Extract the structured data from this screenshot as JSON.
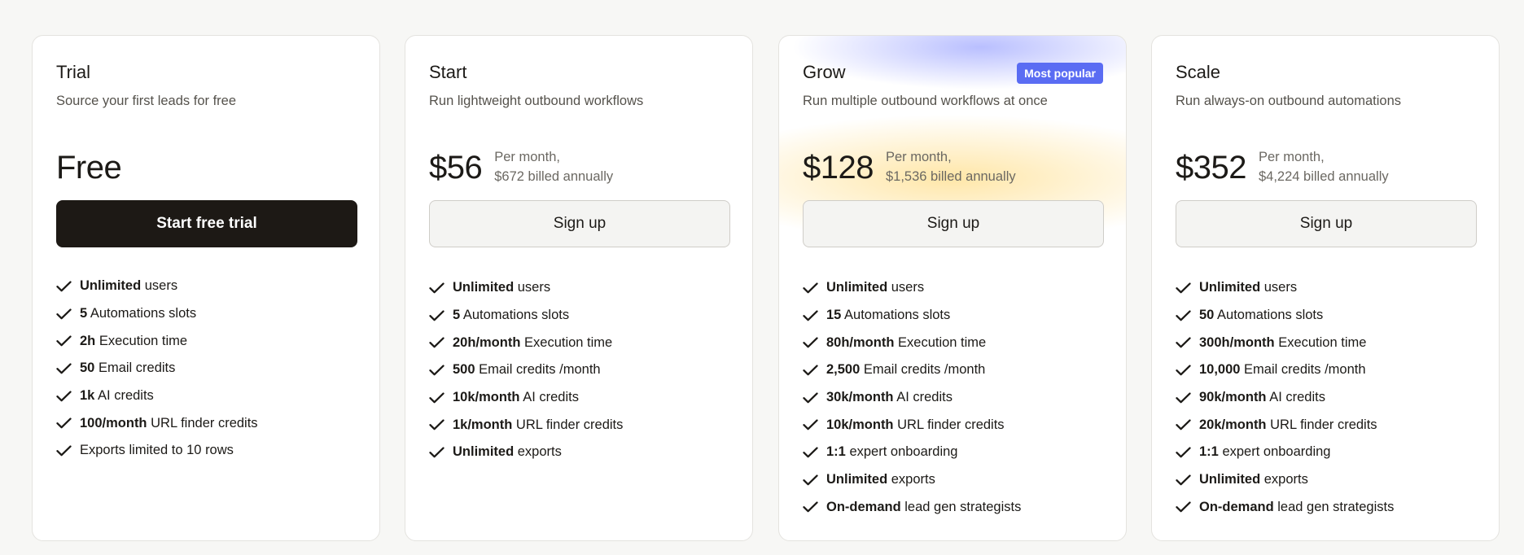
{
  "plans": [
    {
      "name": "Trial",
      "description": "Source your first leads for free",
      "price": "Free",
      "cta": "Start free trial",
      "features": [
        {
          "bold": "Unlimited",
          "rest": " users"
        },
        {
          "bold": "5",
          "rest": " Automations slots"
        },
        {
          "bold": "2h",
          "rest": " Execution time"
        },
        {
          "bold": "50",
          "rest": " Email credits"
        },
        {
          "bold": "1k",
          "rest": " AI credits"
        },
        {
          "bold": "100/month",
          "rest": " URL finder credits"
        },
        {
          "bold": "",
          "rest": "Exports limited to 10 rows"
        }
      ]
    },
    {
      "name": "Start",
      "description": "Run lightweight outbound workflows",
      "price": "$56",
      "price_note_1": "Per month,",
      "price_note_2": "$672 billed annually",
      "cta": "Sign up",
      "features": [
        {
          "bold": "Unlimited",
          "rest": " users"
        },
        {
          "bold": "5",
          "rest": " Automations slots"
        },
        {
          "bold": "20h/month",
          "rest": " Execution time"
        },
        {
          "bold": "500",
          "rest": " Email credits /month"
        },
        {
          "bold": "10k/month",
          "rest": " AI credits"
        },
        {
          "bold": "1k/month",
          "rest": " URL finder credits"
        },
        {
          "bold": "Unlimited",
          "rest": " exports"
        }
      ]
    },
    {
      "name": "Grow",
      "badge": "Most popular",
      "description": "Run multiple outbound workflows at once",
      "price": "$128",
      "price_note_1": "Per month,",
      "price_note_2": "$1,536 billed annually",
      "cta": "Sign up",
      "features": [
        {
          "bold": "Unlimited",
          "rest": " users"
        },
        {
          "bold": "15",
          "rest": " Automations slots"
        },
        {
          "bold": "80h/month",
          "rest": " Execution time"
        },
        {
          "bold": "2,500",
          "rest": " Email credits /month"
        },
        {
          "bold": "30k/month",
          "rest": " AI credits"
        },
        {
          "bold": "10k/month",
          "rest": " URL finder credits"
        },
        {
          "bold": "1:1",
          "rest": " expert onboarding"
        },
        {
          "bold": "Unlimited",
          "rest": " exports"
        },
        {
          "bold": "On-demand",
          "rest": " lead gen strategists"
        }
      ]
    },
    {
      "name": "Scale",
      "description": "Run always-on outbound automations",
      "price": "$352",
      "price_note_1": "Per month,",
      "price_note_2": "$4,224 billed annually",
      "cta": "Sign up",
      "features": [
        {
          "bold": "Unlimited",
          "rest": " users"
        },
        {
          "bold": "50",
          "rest": " Automations slots"
        },
        {
          "bold": "300h/month",
          "rest": " Execution time"
        },
        {
          "bold": "10,000",
          "rest": " Email credits /month"
        },
        {
          "bold": "90k/month",
          "rest": " AI credits"
        },
        {
          "bold": "20k/month",
          "rest": " URL finder credits"
        },
        {
          "bold": "1:1",
          "rest": " expert onboarding"
        },
        {
          "bold": "Unlimited",
          "rest": " exports"
        },
        {
          "bold": "On-demand",
          "rest": " lead gen strategists"
        }
      ]
    }
  ],
  "icons": {
    "feature": "check-icon"
  },
  "colors": {
    "background": "#f7f7f5",
    "card": "#ffffff",
    "primary_button": "#1d1915",
    "secondary_button": "#f4f4f2",
    "badge": "#5a6cf3",
    "text": "#1c1a17",
    "muted_text": "#55524c",
    "glow_purple": "#8a94ff",
    "glow_yellow": "#ffd66e"
  }
}
